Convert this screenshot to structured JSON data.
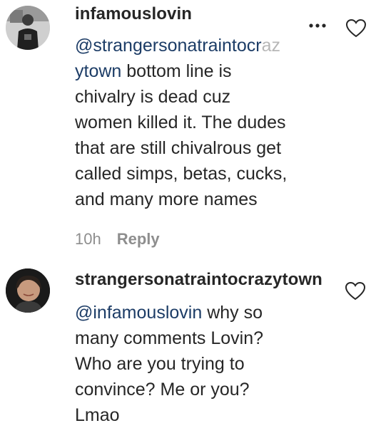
{
  "comments": [
    {
      "username": "infamouslovin",
      "mention_visible": "@strangersonatraintocr",
      "mention_faded": "az",
      "mention_cont": "ytown",
      "lines": [
        " bottom line is",
        "chivalry is dead cuz",
        "women killed it. The dudes",
        "that are still chivalrous get",
        "called simps, betas, cucks,",
        "and many more names"
      ],
      "time": "10h",
      "reply_label": "Reply"
    },
    {
      "username": "strangersonatraintocrazytown",
      "mention": "@infamouslovin",
      "lines": [
        " why so",
        "many comments Lovin?",
        "Who are you trying to",
        "convince? Me or you?",
        "Lmao"
      ]
    }
  ],
  "icons": {
    "more": "more-options-icon",
    "like": "heart-icon"
  }
}
